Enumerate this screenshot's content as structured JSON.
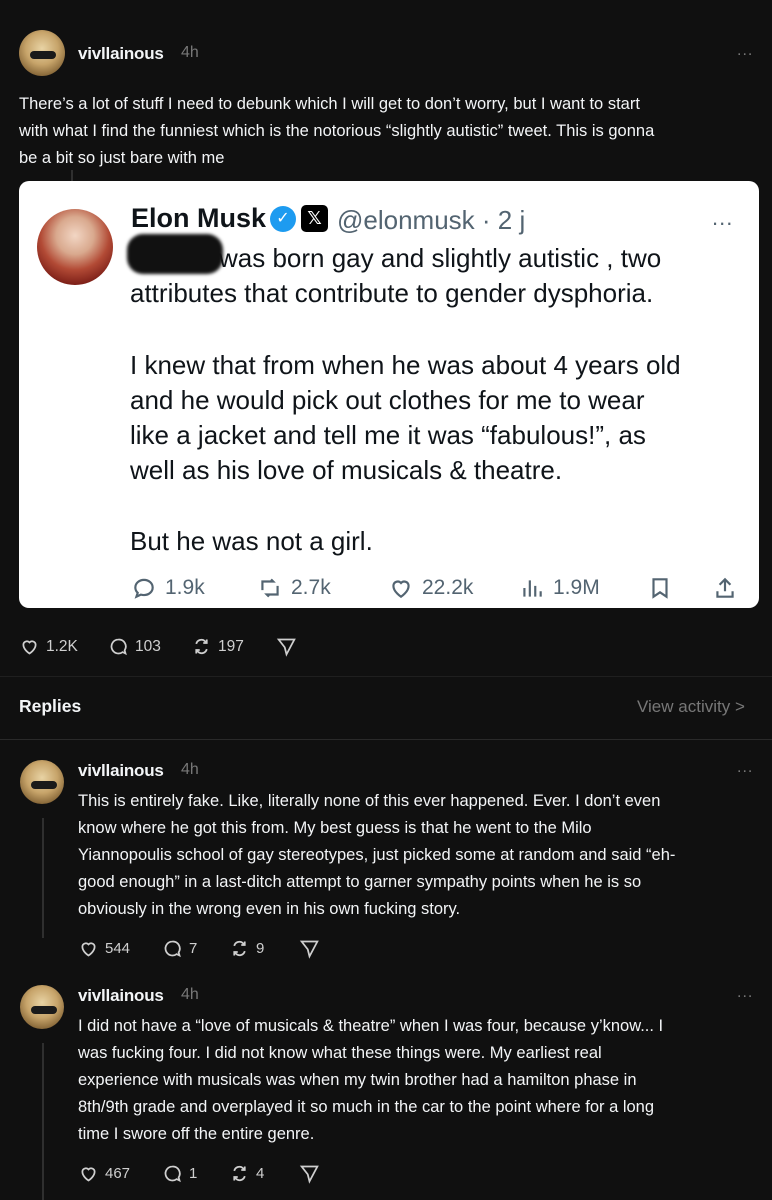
{
  "post": {
    "username": "vivllainous",
    "time": "4h",
    "more": "...",
    "lines": [
      "There’s a lot of stuff I need to debunk which I will get to don’t worry, but I want to start",
      "with what I find the funniest which is the notorious “slightly autistic” tweet. This is gonna",
      "be a bit so just bare with me"
    ],
    "stats": {
      "likes": "1.2K",
      "replies": "103",
      "reposts": "197"
    }
  },
  "embedded_tweet": {
    "name": "Elon Musk",
    "verified_icon": "✓",
    "x_logo": "𝕏",
    "handle": "@elonmusk · 2 j",
    "more": "...",
    "lines": [
      "was born gay and slightly autistic , two",
      "attributes that contribute to gender dysphoria.",
      "I knew that from when he was about 4 years old",
      "and he would pick out clothes for me to wear",
      "like a jacket and tell me it was “fabulous!”, as",
      "well as his love of musicals & theatre.",
      "But he was not a girl."
    ],
    "actions": {
      "replies": "1.9k",
      "reposts": "2.7k",
      "likes": "22.2k",
      "views": "1.9M"
    }
  },
  "replies_header": {
    "label": "Replies",
    "view_activity": "View activity >"
  },
  "replies": [
    {
      "username": "vivllainous",
      "time": "4h",
      "more": "...",
      "lines": [
        "This is entirely fake. Like, literally none of this ever happened. Ever. I don’t even",
        "know where he got this from. My best guess is that he went to the Milo",
        "Yiannopoulis school of gay stereotypes, just picked some at random and said “eh-",
        "good enough” in a last-ditch attempt to garner sympathy points when he is so",
        "obviously in the wrong even in his own fucking story."
      ],
      "stats": {
        "likes": "544",
        "replies": "7",
        "reposts": "9"
      }
    },
    {
      "username": "vivllainous",
      "time": "4h",
      "more": "...",
      "lines": [
        "I did not have a “love of musicals & theatre” when I was four, because y’know... I",
        "was fucking four. I did not know what these things were. My earliest real",
        "experience with musicals was when my twin brother had a hamilton phase in",
        "8th/9th grade and overplayed it so much in the car to the point where for a long",
        "time I swore off the entire genre."
      ],
      "stats": {
        "likes": "467",
        "replies": "1",
        "reposts": "4"
      }
    }
  ],
  "colors": {
    "background": "#101010",
    "text": "#f3f5f7",
    "muted": "#777777",
    "card": "#ffffff",
    "verified": "#1d9bf0"
  }
}
